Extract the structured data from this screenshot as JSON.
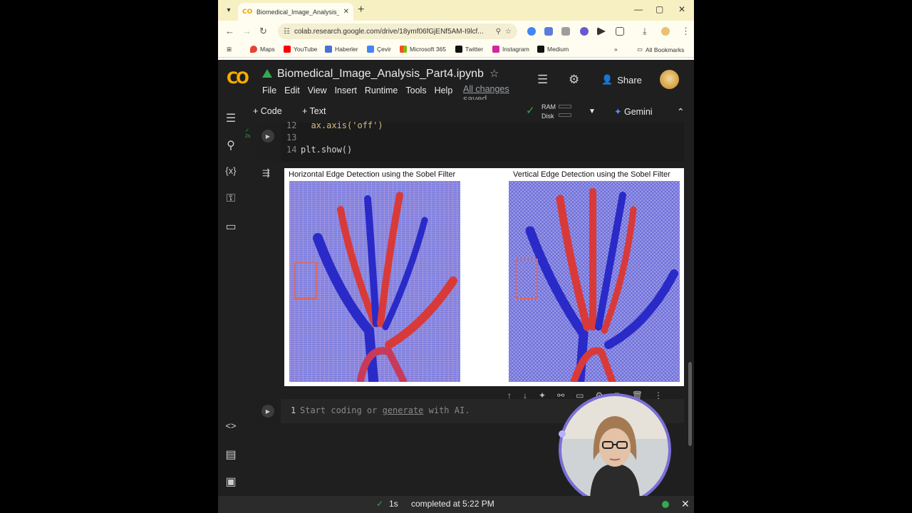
{
  "browser": {
    "tab_title": "Biomedical_Image_Analysis_Par",
    "tab_favicon": "CO",
    "url": "colab.research.google.com/drive/18ymf06fGjENf5AM-I9lcf...",
    "bookmarks": [
      {
        "label": "Maps",
        "color": "#e94235"
      },
      {
        "label": "YouTube",
        "color": "#ff0000"
      },
      {
        "label": "Haberler",
        "color": "#4a6fd8"
      },
      {
        "label": "Çevir",
        "color": "#4285f4"
      },
      {
        "label": "Microsoft 365",
        "color": "#f25022"
      },
      {
        "label": "Twitter",
        "color": "#111111"
      },
      {
        "label": "Instagram",
        "color": "#d6249f"
      },
      {
        "label": "Medium",
        "color": "#111111"
      }
    ],
    "all_bookmarks": "All Bookmarks"
  },
  "colab": {
    "logo": "CO",
    "notebook_title": "Biomedical_Image_Analysis_Part4.ipynb",
    "menu": [
      "File",
      "Edit",
      "View",
      "Insert",
      "Runtime",
      "Tools",
      "Help"
    ],
    "all_changes": "All changes saved",
    "share_label": "Share",
    "toolbar": {
      "code_label": "Code",
      "text_label": "Text",
      "ram_label": "RAM",
      "disk_label": "Disk",
      "gemini_label": "Gemini"
    },
    "code_cell": {
      "lines": [
        {
          "num": "12",
          "code": "  ax.axis('off')"
        },
        {
          "num": "13",
          "code": ""
        },
        {
          "num": "14",
          "code": "plt.show()"
        }
      ]
    },
    "figure": {
      "left_title": "Horizontal Edge Detection using the Sobel Filter",
      "right_title": "Vertical Edge Detection using the Sobel Filter"
    },
    "new_cell": {
      "line_num": "1",
      "placeholder_start": "Start coding or ",
      "placeholder_link": "generate",
      "placeholder_end": " with AI."
    },
    "status": {
      "duration": "1s",
      "completed": "completed at 5:22 PM"
    }
  }
}
